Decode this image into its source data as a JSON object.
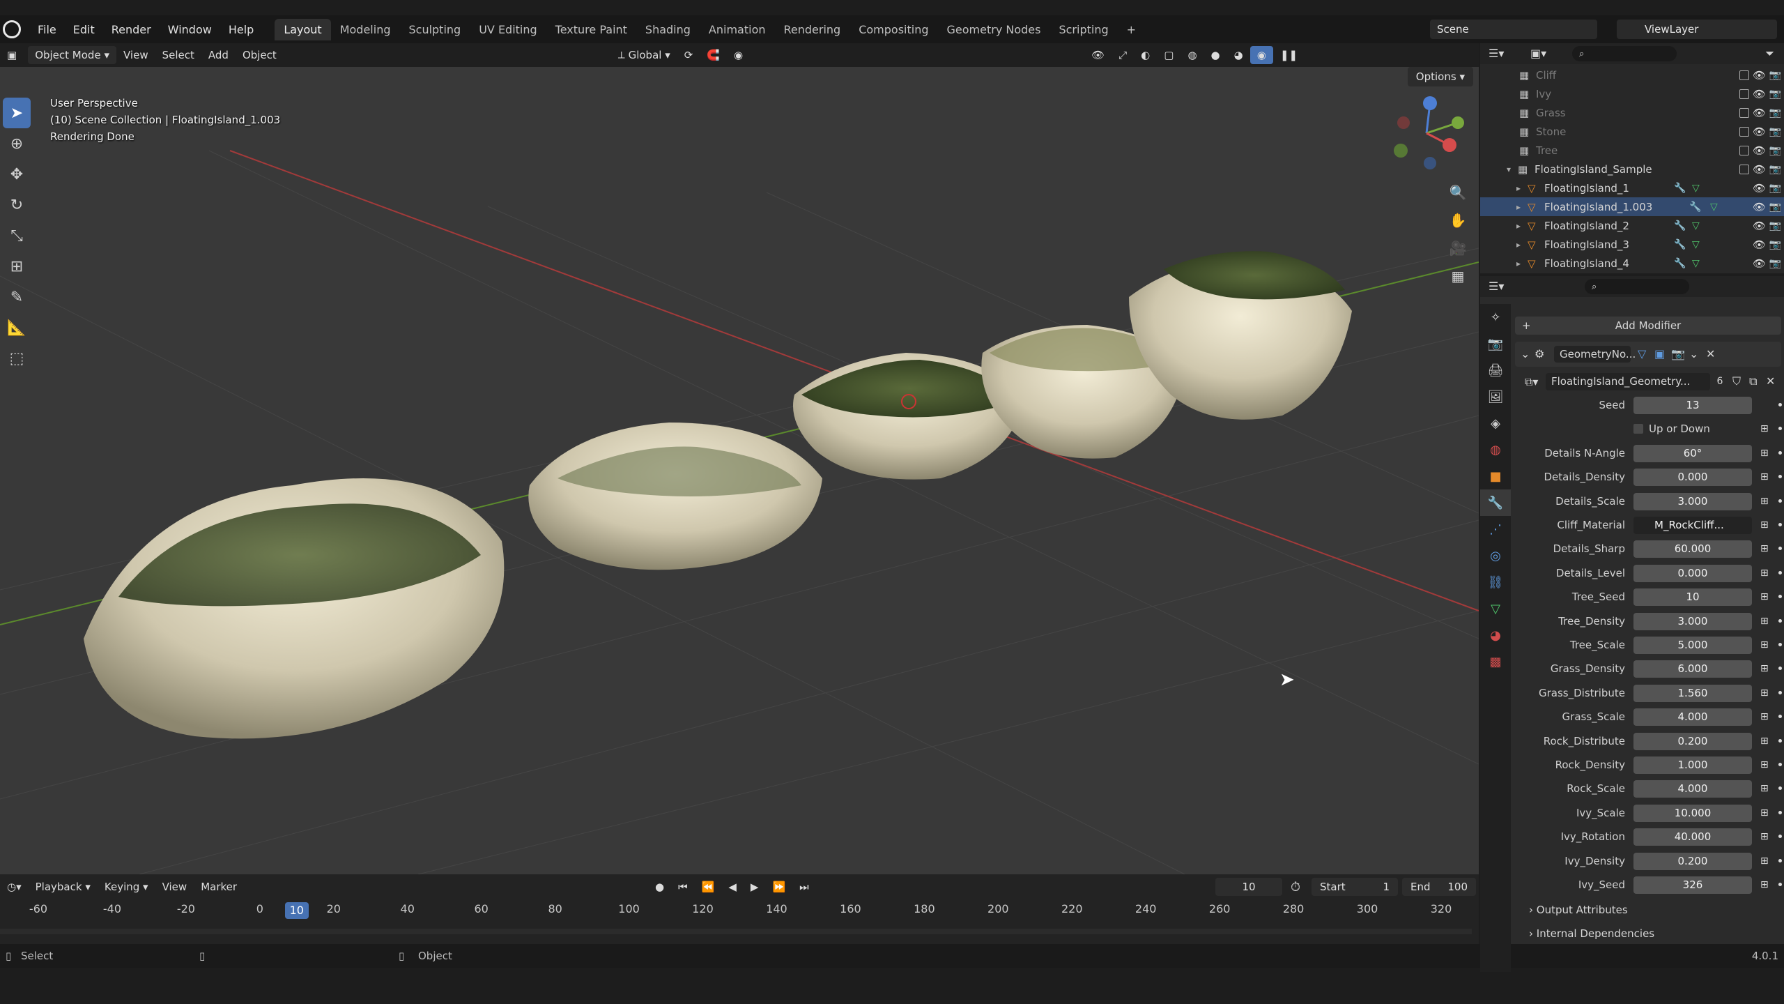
{
  "menu": [
    "File",
    "Edit",
    "Render",
    "Window",
    "Help"
  ],
  "workspaces": [
    "Layout",
    "Modeling",
    "Sculpting",
    "UV Editing",
    "Texture Paint",
    "Shading",
    "Animation",
    "Rendering",
    "Compositing",
    "Geometry Nodes",
    "Scripting"
  ],
  "scene": "Scene",
  "view_layer": "ViewLayer",
  "viewport_header": {
    "mode": "Object Mode",
    "view": "View",
    "select": "Select",
    "add": "Add",
    "object": "Object",
    "orientation": "Global"
  },
  "viewport": {
    "perspective": "User Perspective",
    "collection": "(10) Scene Collection | FloatingIsland_1.003",
    "status": "Rendering Done",
    "options": "Options"
  },
  "outliner": {
    "rows": [
      {
        "name": "Cliff",
        "dim": true
      },
      {
        "name": "Ivy",
        "dim": true
      },
      {
        "name": "Grass",
        "dim": true
      },
      {
        "name": "Stone",
        "dim": true
      },
      {
        "name": "Tree",
        "dim": true
      },
      {
        "name": "FloatingIsland_Sample",
        "dim": false
      },
      {
        "name": "FloatingIsland_1",
        "dim": false
      },
      {
        "name": "FloatingIsland_1.003",
        "dim": false
      },
      {
        "name": "FloatingIsland_2",
        "dim": false
      },
      {
        "name": "FloatingIsland_3",
        "dim": false
      },
      {
        "name": "FloatingIsland_4",
        "dim": false
      }
    ]
  },
  "properties": {
    "add_modifier": "Add Modifier",
    "modifier_name": "GeometryNo...",
    "node_group": "FloatingIsland_Geometry...",
    "node_group_users": "6",
    "up_or_down": "Up or Down",
    "fields": [
      {
        "label": "Seed",
        "value": "13"
      },
      {
        "label": "Details N-Angle",
        "value": "60°"
      },
      {
        "label": "Details_Density",
        "value": "0.000"
      },
      {
        "label": "Details_Scale",
        "value": "3.000"
      },
      {
        "label": "Cliff_Material",
        "value": "M_RockCliff..."
      },
      {
        "label": "Details_Sharp",
        "value": "60.000"
      },
      {
        "label": "Details_Level",
        "value": "0.000"
      },
      {
        "label": "Tree_Seed",
        "value": "10"
      },
      {
        "label": "Tree_Density",
        "value": "3.000"
      },
      {
        "label": "Tree_Scale",
        "value": "5.000"
      },
      {
        "label": "Grass_Density",
        "value": "6.000"
      },
      {
        "label": "Grass_Distribute",
        "value": "1.560"
      },
      {
        "label": "Grass_Scale",
        "value": "4.000"
      },
      {
        "label": "Rock_Distribute",
        "value": "0.200"
      },
      {
        "label": "Rock_Density",
        "value": "1.000"
      },
      {
        "label": "Rock_Scale",
        "value": "4.000"
      },
      {
        "label": "Ivy_Scale",
        "value": "10.000"
      },
      {
        "label": "Ivy_Rotation",
        "value": "40.000"
      },
      {
        "label": "Ivy_Density",
        "value": "0.200"
      },
      {
        "label": "Ivy_Seed",
        "value": "326"
      }
    ],
    "output_attributes": "Output Attributes",
    "internal_dependencies": "Internal Dependencies"
  },
  "timeline": {
    "playback": "Playback",
    "keying": "Keying",
    "view": "View",
    "marker": "Marker",
    "current_frame": "10",
    "start_label": "Start",
    "start": "1",
    "end_label": "End",
    "end": "100",
    "ruler": [
      "-60",
      "-40",
      "-20",
      "0",
      "20",
      "40",
      "60",
      "80",
      "100",
      "120",
      "140",
      "160",
      "180",
      "200",
      "220",
      "240",
      "260",
      "280",
      "300",
      "320"
    ]
  },
  "status": {
    "left": "Select",
    "middle": "Object",
    "version": "4.0.1"
  }
}
